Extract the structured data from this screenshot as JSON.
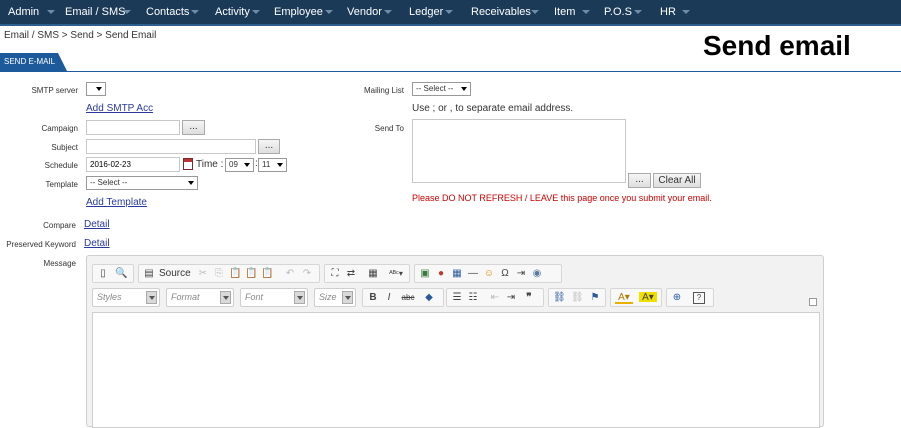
{
  "nav": {
    "items": [
      "Admin",
      "Email / SMS",
      "Contacts",
      "Activity",
      "Employee",
      "Vendor",
      "Ledger",
      "Receivables",
      "Item",
      "P.O.S",
      "HR"
    ]
  },
  "breadcrumb": "Email / SMS > Send > Send Email",
  "page_title": "Send email",
  "tab_label": "SEND E-MAIL",
  "form": {
    "smtp_label": "SMTP server",
    "add_smtp": "Add SMTP Acc",
    "campaign_label": "Campaign",
    "subject_label": "Subject",
    "schedule_label": "Schedule",
    "schedule_value": "2016-02-23",
    "time_label": "Time :",
    "time_hour": "09",
    "time_sep": ":",
    "time_min": "11",
    "template_label": "Template",
    "template_value": "-- Select --",
    "add_template": "Add Template",
    "compare_label": "Compare",
    "compare_link": "Detail",
    "preserved_label": "Preserved Keyword",
    "preserved_link": "Detail",
    "message_label": "Message",
    "mailing_label": "Mailing List",
    "mailing_value": "-- Select --",
    "separator_hint": "Use ; or , to separate email address.",
    "sendto_label": "Send To",
    "clear_all": "Clear All",
    "ellipsis": "...",
    "warning": "Please DO NOT REFRESH / LEAVE this page once you submit your email."
  },
  "editor": {
    "source_label": "Source",
    "combos": [
      "Styles",
      "Format",
      "Font",
      "Size"
    ]
  },
  "colors": {
    "nav_bg": "#1b3a57",
    "tab_bg": "#1c5a9c",
    "link": "#2a3a9c",
    "warning": "#cc0000"
  }
}
